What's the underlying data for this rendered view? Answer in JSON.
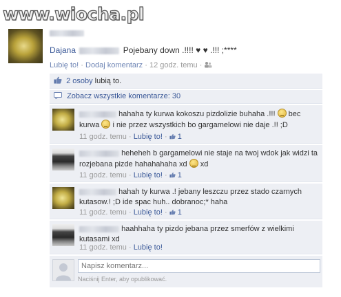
{
  "watermark": "www.wiocha.pl",
  "post": {
    "author": "Dajana",
    "text": "Pojebany down .!!!! ♥ ♥ .!!! ;****",
    "like_label": "Lubię to!",
    "comment_label": "Dodaj komentarz",
    "time": "12 godz. temu",
    "sep": "·"
  },
  "likes": {
    "count_link": "2 osoby",
    "suffix": "lubią to."
  },
  "view_all": "Zobacz wszystkie komentarze: 30",
  "comments": [
    {
      "text_a": "hahaha ty kurwa kokoszu pizdolizie buhaha .!!!",
      "text_b": "bec kurwa",
      "text_c": "i nie przez wszystkich bo gargamelowi nie daje .!! ;D",
      "time": "11 godz. temu",
      "like_label": "Lubię to!",
      "likes": "1"
    },
    {
      "text_a": "heheheh b gargamelowi nie staje na twoj wdok jak widzi ta rozjebana pizde hahahahaha xd",
      "text_b": "xd",
      "time": "11 godz. temu",
      "like_label": "Lubię to!",
      "likes": "1"
    },
    {
      "text_a": "hahah ty kurwa .! jebany leszczu przez stado czarnych kutasow.! ;D ide spac huh.. dobranoc;* haha",
      "time": "11 godz. temu",
      "like_label": "Lubię to!",
      "likes": "1"
    },
    {
      "text_a": "haahhaha ty pizdo jebana przez smerfów z wielkimi kutasami xd",
      "time": "11 godz. temu",
      "like_label": "Lubię to!"
    }
  ],
  "composer": {
    "placeholder": "Napisz komentarz...",
    "hint": "Naciśnij Enter, aby opublikować."
  },
  "colors": {
    "link": "#3b5998",
    "panel": "#edeff4",
    "muted": "#999999"
  }
}
